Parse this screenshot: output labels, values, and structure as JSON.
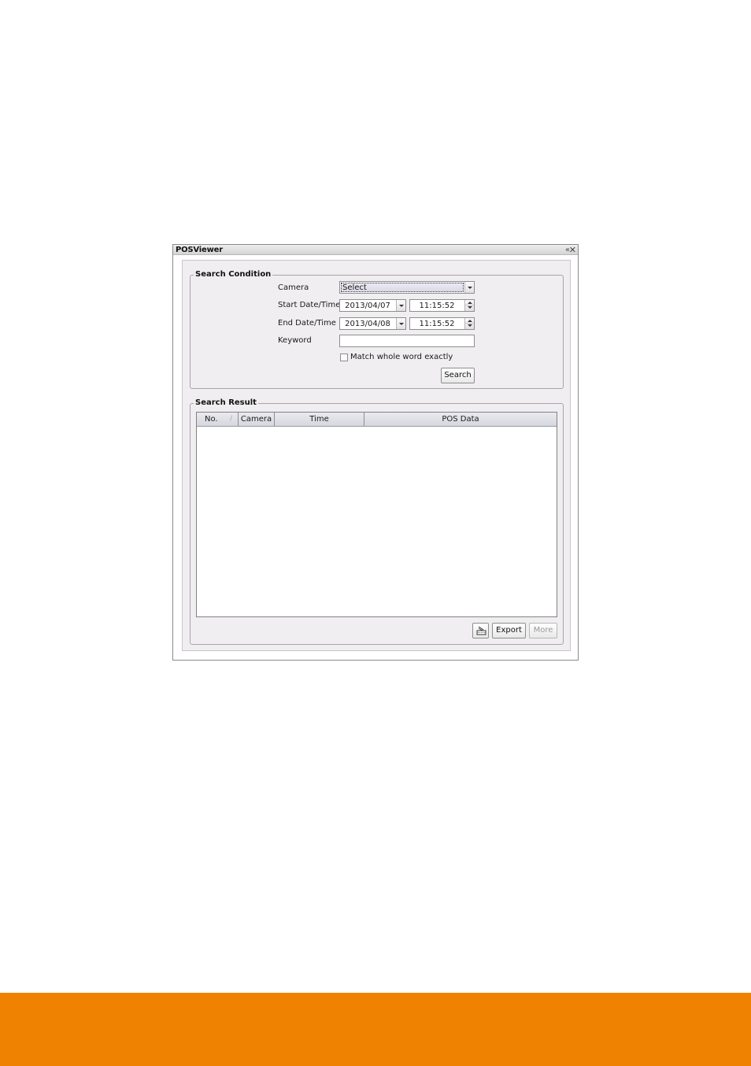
{
  "window": {
    "title": "POSViewer",
    "controls": {
      "collapse_glyph": "«",
      "close_glyph": "✕"
    }
  },
  "search_condition": {
    "legend": "Search Condition",
    "camera": {
      "label": "Camera",
      "value": "Select"
    },
    "start": {
      "label": "Start Date/Time",
      "date": "2013/04/07",
      "time": "11:15:52"
    },
    "end": {
      "label": "End Date/Time",
      "date": "2013/04/08",
      "time": "11:15:52"
    },
    "keyword": {
      "label": "Keyword",
      "value": "",
      "placeholder": ""
    },
    "match_whole_word": {
      "label": "Match whole word exactly",
      "checked": false
    },
    "search_button": "Search"
  },
  "search_result": {
    "legend": "Search Result",
    "columns": [
      {
        "label": "No.",
        "sort_indicator": "/"
      },
      {
        "label": "Camera"
      },
      {
        "label": "Time"
      },
      {
        "label": "POS Data"
      }
    ],
    "rows": [],
    "buttons": {
      "print_icon": "printer-icon",
      "export": "Export",
      "more": "More",
      "more_enabled": false
    }
  },
  "colors": {
    "footer_accent": "#ef8200",
    "panel_bg": "#f0eef0"
  }
}
